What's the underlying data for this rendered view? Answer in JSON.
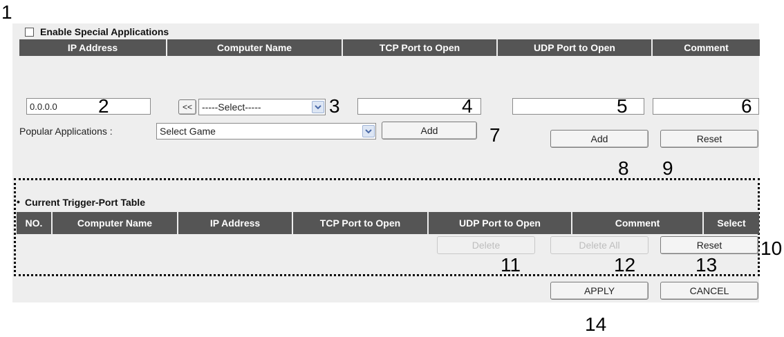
{
  "annotations": {
    "n1": "1",
    "n2": "2",
    "n3": "3",
    "n4": "4",
    "n5": "5",
    "n6": "6",
    "n7": "7",
    "n8": "8",
    "n9": "9",
    "n10": "10",
    "n11": "11",
    "n12": "12",
    "n13": "13",
    "n14": "14"
  },
  "special_apps": {
    "enable_label": "Enable Special Applications",
    "headers": [
      "IP Address",
      "Computer Name",
      "TCP Port to Open",
      "UDP Port to Open",
      "Comment"
    ],
    "ip_value": "0.0.0.0",
    "computer_select_button": "<<",
    "computer_select_value": "-----Select-----",
    "tcp_value": "",
    "udp_value": "",
    "comment_value": ""
  },
  "popular": {
    "label": "Popular Applications  :",
    "select_value": "Select Game",
    "add_label": "Add"
  },
  "form_buttons": {
    "add_label": "Add",
    "reset_label": "Reset"
  },
  "trigger_table": {
    "title": "Current Trigger-Port Table",
    "headers": [
      "NO.",
      "Computer Name",
      "IP Address",
      "TCP Port to Open",
      "UDP Port to Open",
      "Comment",
      "Select"
    ],
    "delete_label": "Delete",
    "delete_all_label": "Delete All",
    "reset_label": "Reset"
  },
  "footer": {
    "apply_label": "APPLY",
    "cancel_label": "CANCEL"
  }
}
